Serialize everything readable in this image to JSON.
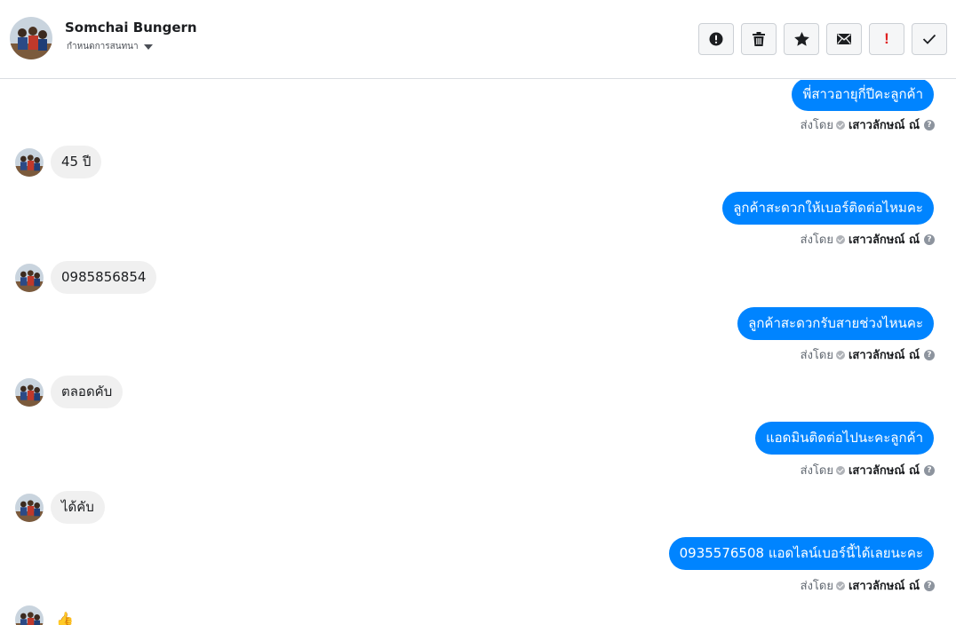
{
  "header": {
    "contact_name": "Somchai Bungern",
    "assign_label": "กำหนดการสนทนา",
    "actions": [
      {
        "name": "report-spam-button",
        "icon": "alert-circle-icon"
      },
      {
        "name": "delete-button",
        "icon": "trash-icon"
      },
      {
        "name": "star-button",
        "icon": "star-icon"
      },
      {
        "name": "mark-unread-button",
        "icon": "envelope-icon"
      },
      {
        "name": "follow-up-button",
        "icon": "exclamation-icon",
        "label": "!"
      },
      {
        "name": "mark-done-button",
        "icon": "checkmark-icon"
      }
    ]
  },
  "thread": {
    "sent_prefix": "ส่งโดย",
    "agent_name": "เสาวลักษณ์ ณ์",
    "messages": [
      {
        "dir": "out",
        "text": "พี่สาวอายุกี่ปีคะลูกค้า"
      },
      {
        "dir": "in",
        "text": "45 ปี"
      },
      {
        "dir": "out",
        "text": "ลูกค้าสะดวกให้เบอร์ติดต่อไหมคะ"
      },
      {
        "dir": "in",
        "text": "0985856854"
      },
      {
        "dir": "out",
        "text": "ลูกค้าสะดวกรับสายช่วงไหนคะ"
      },
      {
        "dir": "in",
        "text": "ตลอดคับ"
      },
      {
        "dir": "out",
        "text": "แอดมินติดต่อไปนะคะลูกค้า"
      },
      {
        "dir": "in",
        "text": "ได้คับ"
      },
      {
        "dir": "out",
        "text": "0935576508 แอดไลน์เบอร์นี้ได้เลยนะคะ"
      },
      {
        "dir": "in",
        "text": "👍"
      }
    ]
  },
  "colors": {
    "outgoing_bubble": "#0084ff",
    "incoming_bubble": "#f0f0f0",
    "follow_up_accent": "#e02020"
  }
}
